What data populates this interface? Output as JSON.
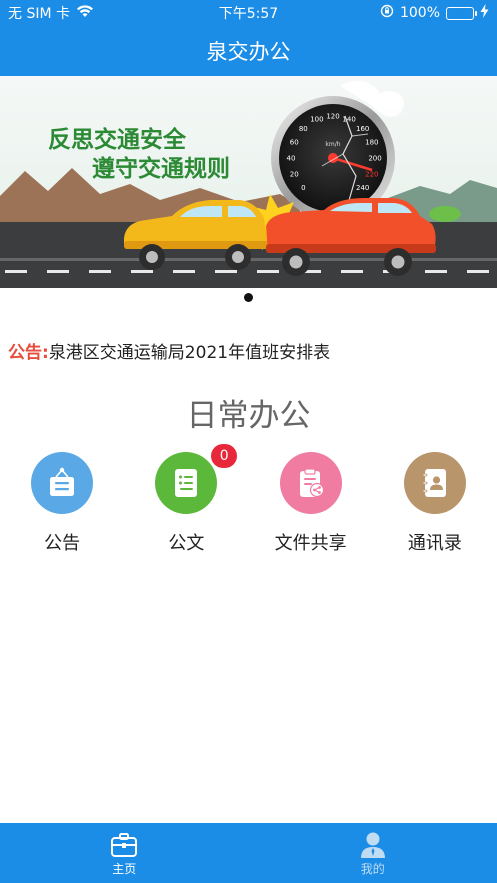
{
  "status_bar": {
    "carrier": "无 SIM 卡",
    "time": "下午5:57",
    "battery": "100%",
    "battery_level": 1.0,
    "icons": [
      "wifi-icon",
      "orientation-lock-icon",
      "battery-icon",
      "charging-icon"
    ]
  },
  "nav": {
    "title": "泉交办公"
  },
  "banner": {
    "line1": "反思交通安全",
    "line2": "遵守交通规则",
    "speedometer": {
      "unit": "km/h",
      "ticks": [
        "0",
        "20",
        "40",
        "60",
        "80",
        "100",
        "120",
        "140",
        "160",
        "180",
        "200",
        "220",
        "240"
      ]
    },
    "slide_count": 1,
    "active_slide": 1
  },
  "notice": {
    "label": "公告:",
    "text": "泉港区交通运输局2021年值班安排表"
  },
  "section": {
    "title": "日常办公"
  },
  "grid": [
    {
      "label": "公告",
      "icon": "notice-board-icon",
      "color": "#5aa9e6"
    },
    {
      "label": "公文",
      "icon": "document-icon",
      "color": "#5cb83a",
      "badge": "0"
    },
    {
      "label": "文件共享",
      "icon": "file-share-icon",
      "color": "#f07ca2"
    },
    {
      "label": "通讯录",
      "icon": "contacts-book-icon",
      "color": "#b9956c"
    }
  ],
  "tabs": [
    {
      "label": "主页",
      "icon": "briefcase-icon",
      "active": true
    },
    {
      "label": "我的",
      "icon": "user-profile-icon",
      "active": false
    }
  ],
  "colors": {
    "primary": "#1b8de6",
    "notice_label": "#e74c3c",
    "badge": "#e8283a"
  }
}
